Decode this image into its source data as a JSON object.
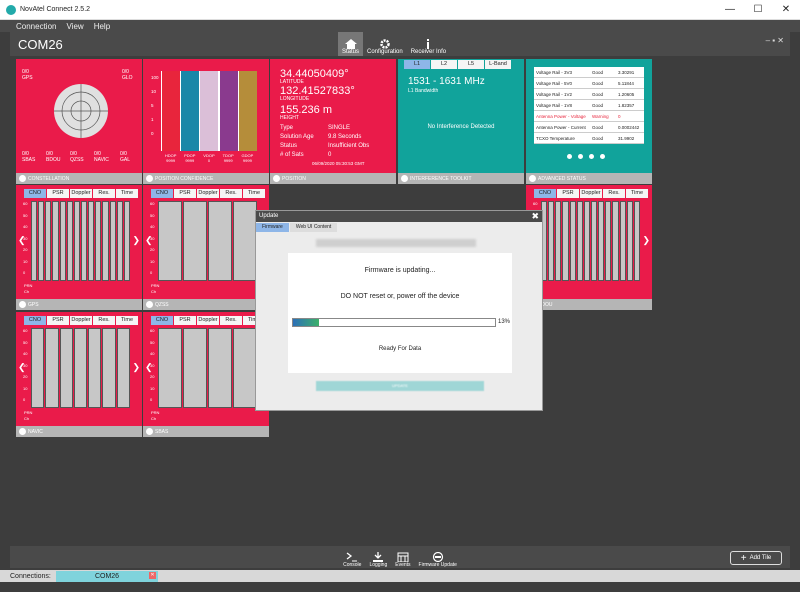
{
  "window": {
    "title": "NovAtel Connect 2.5.2",
    "minimize": "—",
    "maximize": "☐",
    "close": "✕"
  },
  "menu": [
    "Connection",
    "View",
    "Help"
  ],
  "header": {
    "title": "COM26",
    "tabs": [
      {
        "label": "Status",
        "icon": "home-icon"
      },
      {
        "label": "Configuration",
        "icon": "gear-icon"
      },
      {
        "label": "Receiver Info",
        "icon": "info-icon"
      }
    ],
    "ctrls": "– ▪ ✕"
  },
  "constellation": {
    "labels": [
      "GPS",
      "GLO",
      "SBAS",
      "BDOU",
      "QZSS",
      "NAVIC",
      "GAL"
    ],
    "counts": [
      "0/0",
      "0/0",
      "0/0",
      "0/0",
      "0/0",
      "0/0",
      "0/0"
    ],
    "footer": "CONSTELLATION"
  },
  "confidence": {
    "y_ticks": [
      "100",
      "10",
      "5",
      "1",
      "0"
    ],
    "x_labels": [
      "HDOP",
      "PDOP",
      "VDOP",
      "TDOP",
      "GDOP"
    ],
    "x_values": [
      "9999",
      "9999",
      "0",
      "9999",
      "9999"
    ],
    "footer": "POSITION CONFIDENCE",
    "colors": [
      "#e8253c",
      "#1a87a8",
      "#dbbfd8",
      "#8a3a8e",
      "#b58d3a"
    ]
  },
  "position": {
    "lat": "34.44050409°",
    "lat_label": "LATITUDE",
    "lon": "132.41527833°",
    "lon_label": "LONGITUDE",
    "height": "155.236 m",
    "height_label": "HEIGHT",
    "rows": [
      [
        "Type",
        "SINGLE"
      ],
      [
        "Solution Age",
        "9.8 Seconds"
      ],
      [
        "Status",
        "Insufficient Obs"
      ],
      [
        "# of Sats",
        "0"
      ]
    ],
    "time": "06/09/2020 05:30:53 GMT",
    "footer": "POSITION"
  },
  "interference": {
    "bands": [
      "L1",
      "L2",
      "L5",
      "L-Band"
    ],
    "freq": "1531 - 1631 MHz",
    "freq_label": "L1 Bandwidth",
    "message": "No Interference Detected",
    "footer": "INTERFERENCE TOOLKIT"
  },
  "advanced": {
    "rows": [
      [
        "Voltage Rail - 3V3",
        "Good",
        "3.30291"
      ],
      [
        "Voltage Rail - 5V0",
        "Good",
        "5.11844"
      ],
      [
        "Voltage Rail - 1V2",
        "Good",
        "1.20605"
      ],
      [
        "Voltage Rail - 1V8",
        "Good",
        "1.82357"
      ],
      [
        "Antenna Power - Voltage",
        "Warning",
        "0"
      ],
      [
        "Antenna Power - Current",
        "Good",
        "0.0002442"
      ],
      [
        "TCXO Temperature",
        "Good",
        "31.9902"
      ]
    ],
    "footer": "ADVANCED STATUS"
  },
  "signal_tabs": [
    "CNO",
    "PSR",
    "Doppler",
    "Res.",
    "Time"
  ],
  "signal_y": [
    "60",
    "50",
    "40",
    "30",
    "20",
    "10",
    "0"
  ],
  "tiles": [
    {
      "footer": "GPS"
    },
    {
      "footer": "QZSS"
    },
    {
      "footer": "BDOU"
    },
    {
      "footer": "NAVIC"
    },
    {
      "footer": "SBAS"
    }
  ],
  "prn_label": "PRN",
  "ch_label": "Ch",
  "update": {
    "title": "Update",
    "tabs": [
      "Firmware",
      "Web UI Content"
    ],
    "heading": "Firmware is updating...",
    "warning": "DO NOT reset or, power off the device",
    "percent": "13%",
    "progress": 0.13,
    "status": "Ready For Data",
    "button": "UPDATE",
    "close": "✖"
  },
  "toolbar": [
    {
      "label": "Console",
      "icon": "console-icon"
    },
    {
      "label": "Logging",
      "icon": "download-icon"
    },
    {
      "label": "Events",
      "icon": "calendar-icon"
    },
    {
      "label": "Firmware Update",
      "icon": "firmware-icon"
    }
  ],
  "add_tile": "Add Tile",
  "status": {
    "connections": "Connections:",
    "tab": "COM26",
    "close": "✕"
  }
}
